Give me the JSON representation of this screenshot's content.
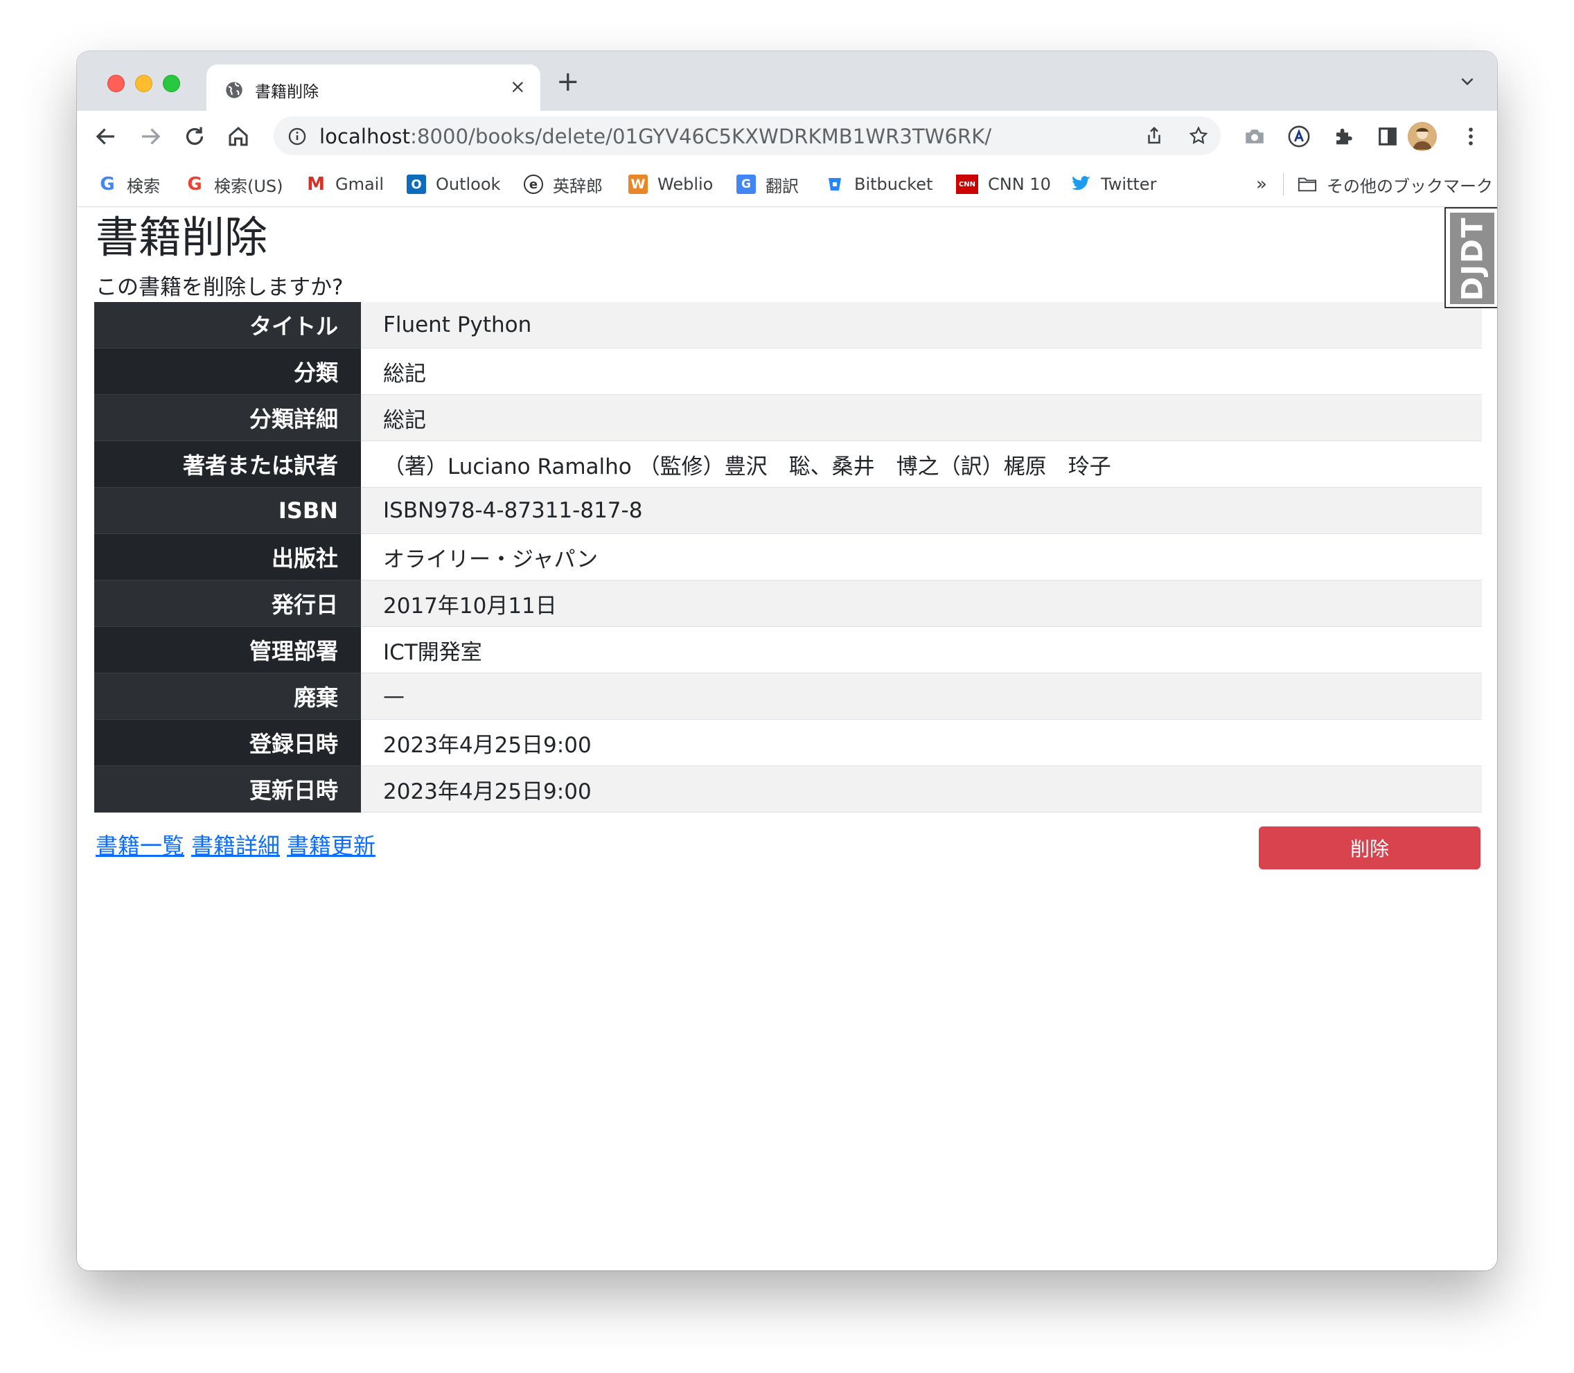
{
  "browser": {
    "tab_title": "書籍削除",
    "tab_close": "×",
    "new_tab": "+",
    "url_host": "localhost",
    "url_rest": ":8000/books/delete/01GYV46C5KXWDRKMB1WR3TW6RK/",
    "icons": [
      "back-icon",
      "forward-icon",
      "reload-icon",
      "home-icon",
      "info-icon",
      "share-icon",
      "star-icon",
      "camera-icon",
      "a-extension-icon",
      "puzzle-icon",
      "sidepanel-icon",
      "avatar",
      "menu-icon"
    ]
  },
  "bookmarks": {
    "items": [
      {
        "label": "検索",
        "icon": "G"
      },
      {
        "label": "検索(US)",
        "icon": "G"
      },
      {
        "label": "Gmail",
        "icon": "M"
      },
      {
        "label": "Outlook",
        "icon": "O"
      },
      {
        "label": "英辞郎",
        "icon": "e"
      },
      {
        "label": "Weblio",
        "icon": "W"
      },
      {
        "label": "翻訳",
        "icon": "G"
      },
      {
        "label": "Bitbucket",
        "icon": "b"
      },
      {
        "label": "CNN 10",
        "icon": "CNN"
      },
      {
        "label": "Twitter",
        "icon": "t"
      }
    ],
    "overflow": "»",
    "other": "その他のブックマーク"
  },
  "page": {
    "heading": "書籍削除",
    "lead": "この書籍を削除しますか?",
    "rows": [
      {
        "label": "タイトル",
        "value": "Fluent Python"
      },
      {
        "label": "分類",
        "value": "総記"
      },
      {
        "label": "分類詳細",
        "value": "総記"
      },
      {
        "label": "著者または訳者",
        "value": "（著）Luciano Ramalho （監修）豊沢　聡、桑井　博之（訳）梶原　玲子"
      },
      {
        "label": "ISBN",
        "value": "ISBN978-4-87311-817-8"
      },
      {
        "label": "出版社",
        "value": "オライリー・ジャパン"
      },
      {
        "label": "発行日",
        "value": "2017年10月11日"
      },
      {
        "label": "管理部署",
        "value": "ICT開発室"
      },
      {
        "label": "廃棄",
        "value": "—"
      },
      {
        "label": "登録日時",
        "value": "2023年4月25日9:00"
      },
      {
        "label": "更新日時",
        "value": "2023年4月25日9:00"
      }
    ],
    "links": {
      "list": "書籍一覧",
      "detail": "書籍詳細",
      "update": "書籍更新"
    },
    "delete_button": "削除",
    "djdt": "DJDT"
  },
  "colors": {
    "danger": "#d9434e",
    "link": "#0d6efd",
    "th_dark": "#212529"
  }
}
